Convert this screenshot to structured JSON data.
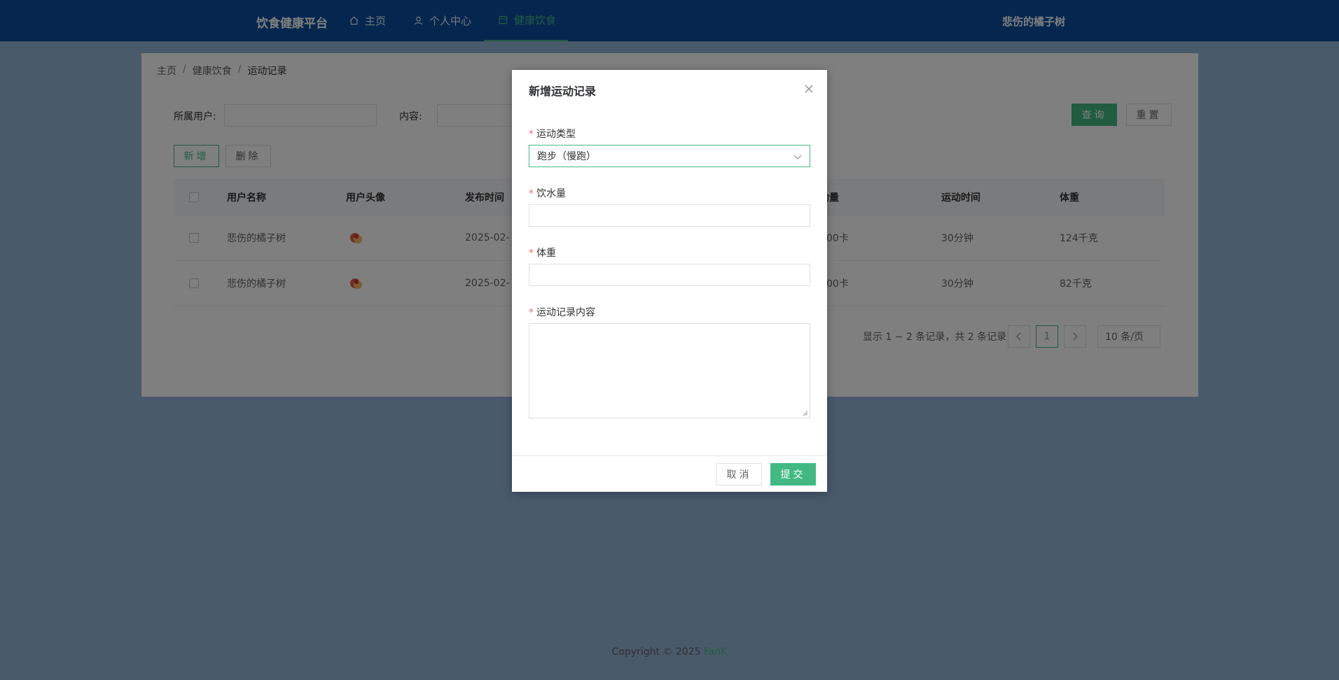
{
  "header": {
    "brand": "饮食健康平台",
    "nav": [
      {
        "label": "主页",
        "icon": "home-icon"
      },
      {
        "label": "个人中心",
        "icon": "user-icon"
      },
      {
        "label": "健康饮食",
        "icon": "calendar-icon"
      }
    ],
    "active_nav": "健康饮食",
    "username": "悲伤的橘子树"
  },
  "breadcrumb": {
    "items": [
      "主页",
      "健康饮食",
      "运动记录"
    ],
    "separator": "/"
  },
  "filters": {
    "user_label": "所属用户:",
    "user_value": "",
    "content_label": "内容:",
    "content_value": ""
  },
  "buttons": {
    "query": "查询",
    "reset": "重置",
    "add": "新增",
    "delete": "删除"
  },
  "table": {
    "columns": [
      "用户名称",
      "用户头像",
      "发布时间",
      "运动量",
      "运动时间",
      "体重"
    ],
    "rows": [
      {
        "user": "悲伤的橘子树",
        "time": "2025-02-",
        "amount": "00卡",
        "duration": "30分钟",
        "weight": "124千克"
      },
      {
        "user": "悲伤的橘子树",
        "time": "2025-02-",
        "amount": "00卡",
        "duration": "30分钟",
        "weight": "82千克"
      }
    ]
  },
  "pagination": {
    "summary": "显示 1 ~ 2 条记录，共 2 条记录",
    "current_page": "1",
    "page_size": "10 条/页"
  },
  "footer": {
    "copyright": "Copyright © 2025 ",
    "author": "FanK"
  },
  "dialog": {
    "title": "新增运动记录",
    "fields": {
      "type_label": "运动类型",
      "type_value": "跑步（慢跑）",
      "water_label": "饮水量",
      "water_value": "",
      "weight_label": "体重",
      "weight_value": "",
      "content_label": "运动记录内容",
      "content_value": ""
    },
    "cancel": "取消",
    "submit": "提交"
  },
  "colors": {
    "accent": "#42b983",
    "header": "#0a4f9e",
    "required": "#f56c6c"
  }
}
